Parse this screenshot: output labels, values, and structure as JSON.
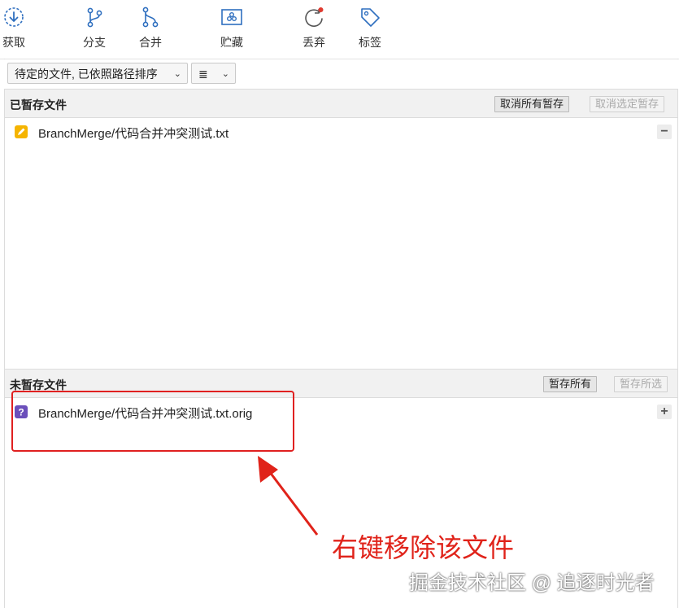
{
  "toolbar": {
    "items": [
      {
        "label": "获取",
        "icon": "fetch-icon"
      },
      {
        "label": "分支",
        "icon": "branch-icon"
      },
      {
        "label": "合并",
        "icon": "merge-icon"
      },
      {
        "label": "贮藏",
        "icon": "stash-icon"
      },
      {
        "label": "丢弃",
        "icon": "discard-icon"
      },
      {
        "label": "标签",
        "icon": "tag-icon"
      }
    ]
  },
  "filter": {
    "sort_dropdown": "待定的文件, 已依照路径排序",
    "view_dropdown": "≣"
  },
  "staged": {
    "title": "已暂存文件",
    "unstage_all_label": "取消所有暂存",
    "unstage_selected_label": "取消选定暂存",
    "files": [
      {
        "path": "BranchMerge/代码合并冲突测试.txt",
        "status": "modified",
        "status_color": "#f5b400",
        "action": "−"
      }
    ]
  },
  "unstaged": {
    "title": "未暂存文件",
    "stage_all_label": "暂存所有",
    "stage_selected_label": "暂存所选",
    "files": [
      {
        "path": "BranchMerge/代码合并冲突测试.txt.orig",
        "status": "untracked",
        "status_color": "#6b4fbb",
        "action": "+"
      }
    ]
  },
  "annotation": {
    "text": "右键移除该文件",
    "color": "#e0231a"
  },
  "watermark": "掘金技术社区 @ 追逐时光者",
  "colors": {
    "accent": "#2f6fbf",
    "discard_dot": "#e03a2f"
  }
}
